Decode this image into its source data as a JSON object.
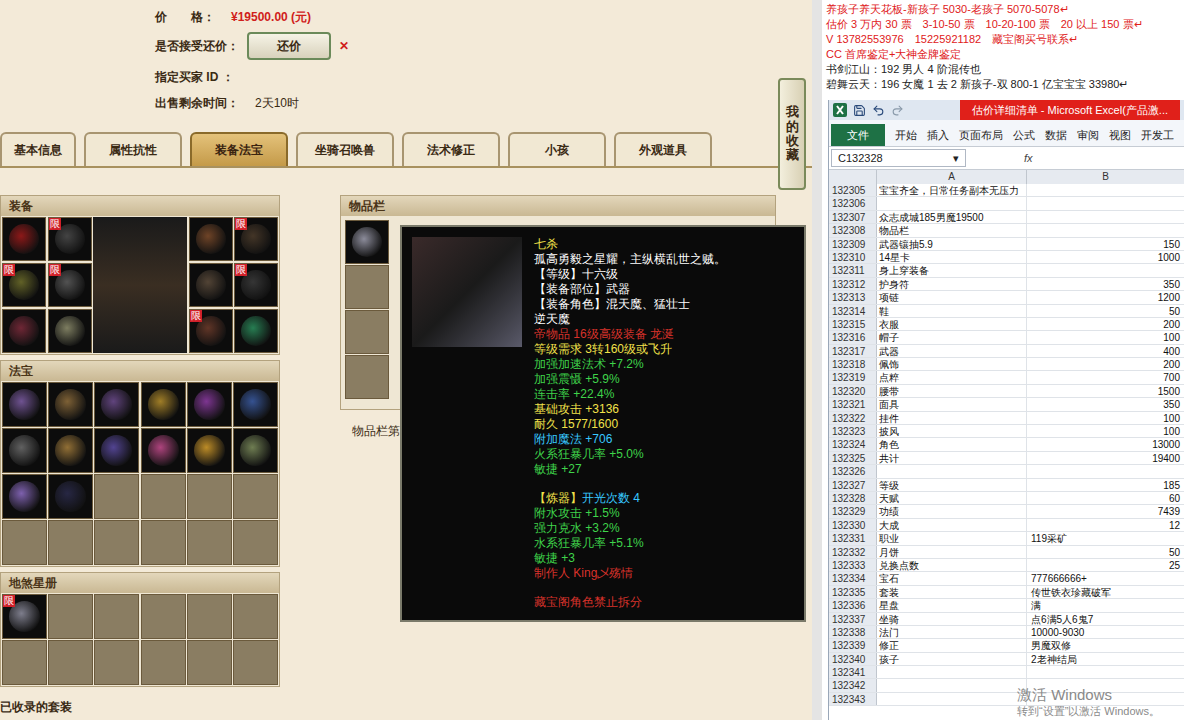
{
  "price": {
    "label": "价　　格：",
    "value": "¥19500.00 (元)"
  },
  "bargain": {
    "label": "是否接受还价：",
    "button": "还价",
    "mark": "✕"
  },
  "buyer": {
    "label": "指定买家 ID ："
  },
  "remaining": {
    "label": "出售剩余时间：",
    "value": "2天10时"
  },
  "favorite_button": "我的收藏",
  "tabs": [
    {
      "label": "基本信息",
      "selected": false
    },
    {
      "label": "属性抗性",
      "selected": false
    },
    {
      "label": "装备法宝",
      "selected": true
    },
    {
      "label": "坐骑召唤兽",
      "selected": false
    },
    {
      "label": "法术修正",
      "selected": false
    },
    {
      "label": "小孩",
      "selected": false
    },
    {
      "label": "外观道具",
      "selected": false
    }
  ],
  "equipment": {
    "title": "装备",
    "left": [
      {
        "filled": true,
        "badge": "",
        "color": "#9b1a1a"
      },
      {
        "filled": true,
        "badge": "限",
        "color": "#4a4a4a"
      },
      {
        "filled": true,
        "badge": "限",
        "color": "#6b6b2a"
      },
      {
        "filled": true,
        "badge": "限",
        "color": "#5a5a5a"
      },
      {
        "filled": true,
        "badge": "",
        "color": "#7a2a3a"
      },
      {
        "filled": true,
        "badge": "",
        "color": "#8a8a6a"
      }
    ],
    "right": [
      {
        "filled": true,
        "badge": "",
        "color": "#7a4a2a"
      },
      {
        "filled": true,
        "badge": "限",
        "color": "#4a3a2a"
      },
      {
        "filled": true,
        "badge": "",
        "color": "#5a4a3a"
      },
      {
        "filled": true,
        "badge": "限",
        "color": "#3a3a3a"
      },
      {
        "filled": true,
        "badge": "限",
        "color": "#6a3a2a"
      },
      {
        "filled": true,
        "badge": "",
        "color": "#2a8a5a"
      }
    ]
  },
  "treasures": {
    "title": "法宝",
    "slots": [
      {
        "filled": true,
        "color": "#7a5aa0"
      },
      {
        "filled": true,
        "color": "#8a6a3a"
      },
      {
        "filled": true,
        "color": "#6a4a8a"
      },
      {
        "filled": true,
        "color": "#b08a2a"
      },
      {
        "filled": true,
        "color": "#8a3aa0"
      },
      {
        "filled": true,
        "color": "#3a5aa0"
      },
      {
        "filled": true,
        "color": "#6a6a6a"
      },
      {
        "filled": true,
        "color": "#a07a3a"
      },
      {
        "filled": true,
        "color": "#5a4aa0"
      },
      {
        "filled": true,
        "color": "#c04a8a"
      },
      {
        "filled": true,
        "color": "#d09a2a"
      },
      {
        "filled": true,
        "color": "#7a8a5a"
      },
      {
        "filled": true,
        "color": "#8a6ac0"
      },
      {
        "filled": true,
        "color": "#2a2a4a"
      },
      {
        "filled": false,
        "color": ""
      },
      {
        "filled": false,
        "color": ""
      },
      {
        "filled": false,
        "color": ""
      },
      {
        "filled": false,
        "color": ""
      },
      {
        "filled": false,
        "color": ""
      },
      {
        "filled": false,
        "color": ""
      },
      {
        "filled": false,
        "color": ""
      },
      {
        "filled": false,
        "color": ""
      },
      {
        "filled": false,
        "color": ""
      },
      {
        "filled": false,
        "color": ""
      }
    ]
  },
  "star_book": {
    "title": "地煞星册",
    "slots": [
      {
        "filled": true,
        "badge": "限",
        "color": "#8a8a9a"
      },
      {
        "filled": false,
        "badge": "",
        "color": ""
      },
      {
        "filled": false,
        "badge": "",
        "color": ""
      },
      {
        "filled": false,
        "badge": "",
        "color": ""
      },
      {
        "filled": false,
        "badge": "",
        "color": ""
      },
      {
        "filled": false,
        "badge": "",
        "color": ""
      },
      {
        "filled": false,
        "badge": "",
        "color": ""
      },
      {
        "filled": false,
        "badge": "",
        "color": ""
      },
      {
        "filled": false,
        "badge": "",
        "color": ""
      },
      {
        "filled": false,
        "badge": "",
        "color": ""
      },
      {
        "filled": false,
        "badge": "",
        "color": ""
      },
      {
        "filled": false,
        "badge": "",
        "color": ""
      }
    ]
  },
  "inventory": {
    "title": "物品栏",
    "caption": "物品栏第",
    "slots": [
      {
        "filled": true,
        "color": "#9a9aaa"
      },
      {
        "filled": false,
        "color": ""
      },
      {
        "filled": false,
        "color": ""
      },
      {
        "filled": false,
        "color": ""
      }
    ]
  },
  "tooltip": {
    "lines": [
      {
        "text": "七杀",
        "color": "#f2e24a",
        "gap_before": false
      },
      {
        "text": "孤高勇毅之星耀，主纵横乱世之贼。",
        "color": "#ffffff",
        "gap_before": false
      },
      {
        "text": "【等级】十六级",
        "color": "#ffffff",
        "gap_before": false
      },
      {
        "text": "【装备部位】武器",
        "color": "#ffffff",
        "gap_before": false
      },
      {
        "text": "【装备角色】混天魔、猛壮士",
        "color": "#ffffff",
        "gap_before": false
      },
      {
        "text": "逆天魔",
        "color": "#ffffff",
        "gap_before": false
      },
      {
        "text": "帝物品 16级高级装备 龙涎",
        "color": "#d8322a",
        "gap_before": false
      },
      {
        "text": "等级需求 3转160级或飞升",
        "color": "#f2e24a",
        "gap_before": false
      },
      {
        "text": "加强加速法术 +7.2%",
        "color": "#3fd44a",
        "gap_before": false
      },
      {
        "text": "加强震慑 +5.9%",
        "color": "#3fd44a",
        "gap_before": false
      },
      {
        "text": "连击率 +22.4%",
        "color": "#3fd44a",
        "gap_before": false
      },
      {
        "text": "基础攻击 +3136",
        "color": "#f2e24a",
        "gap_before": false
      },
      {
        "text": "耐久 1577/1600",
        "color": "#f2e24a",
        "gap_before": false
      },
      {
        "text": "附加魔法 +706",
        "color": "#38c8ff",
        "gap_before": false
      },
      {
        "text": "火系狂暴几率 +5.0%",
        "color": "#3fd44a",
        "gap_before": false
      },
      {
        "text": "敏捷 +27",
        "color": "#3fd44a",
        "gap_before": false
      },
      {
        "text": "【炼器】",
        "color": "#f2e24a",
        "gap_before": true,
        "suffix": "开光次数 4",
        "suffix_color": "#38c8ff"
      },
      {
        "text": "附水攻击 +1.5%",
        "color": "#3fd44a",
        "gap_before": false
      },
      {
        "text": "强力克水 +3.2%",
        "color": "#3fd44a",
        "gap_before": false
      },
      {
        "text": "水系狂暴几率 +5.1%",
        "color": "#3fd44a",
        "gap_before": false
      },
      {
        "text": "敏捷 +3",
        "color": "#3fd44a",
        "gap_before": false
      },
      {
        "text": "制作人 King乄殇情",
        "color": "#d8322a",
        "gap_before": false
      },
      {
        "text": "藏宝阁角色禁止拆分",
        "color": "#d8322a",
        "gap_before": true
      }
    ]
  },
  "bottom_section": "已收录的套装",
  "notes": [
    {
      "text": "养孩子养天花板-新孩子 5030-老孩子 5070-5078↵",
      "color": "#e0201a"
    },
    {
      "text": "估价 3 万内 30 票　3-10-50 票　10-20-100 票　20 以上 150 票↵",
      "color": "#e0201a"
    },
    {
      "text": "V 13782553976　15225921182　藏宝阁买号联系↵",
      "color": "#e0201a"
    },
    {
      "text": "CC 首席鉴定+大神金牌鉴定",
      "color": "#e0201a"
    },
    {
      "text": "书剑江山：192 男人 4 阶混传也",
      "color": "#222222"
    },
    {
      "text": "碧舞云天：196 女魔 1 去 2 新孩子-双 800-1 亿宝宝宝 33980↵",
      "color": "#222222"
    }
  ],
  "excel": {
    "title": "估价详细清单 - Microsoft Excel(产品激...",
    "ribbon": [
      {
        "label": "文件",
        "selected": true
      },
      {
        "label": "开始",
        "selected": false
      },
      {
        "label": "插入",
        "selected": false
      },
      {
        "label": "页面布局",
        "selected": false
      },
      {
        "label": "公式",
        "selected": false
      },
      {
        "label": "数据",
        "selected": false
      },
      {
        "label": "审阅",
        "selected": false
      },
      {
        "label": "视图",
        "selected": false
      },
      {
        "label": "开发工",
        "selected": false
      }
    ],
    "name_box": "C132328",
    "name_box_arrow": "▾",
    "fx": "fx",
    "columns": [
      "A",
      "B"
    ],
    "rows": [
      {
        "num": "132305",
        "a": "宝宝齐全，日常任务副本无压力",
        "b": ""
      },
      {
        "num": "132306",
        "a": "",
        "b": ""
      },
      {
        "num": "132307",
        "a": "众志成城185男魔19500",
        "b": ""
      },
      {
        "num": "132308",
        "a": "物品栏",
        "b": ""
      },
      {
        "num": "132309",
        "a": "武器镶抽5.9",
        "b": "150"
      },
      {
        "num": "132310",
        "a": "14星卡",
        "b": "1000"
      },
      {
        "num": "132311",
        "a": "身上穿装备",
        "b": ""
      },
      {
        "num": "132312",
        "a": "护身符",
        "b": "350"
      },
      {
        "num": "132313",
        "a": "项链",
        "b": "1200"
      },
      {
        "num": "132314",
        "a": "鞋",
        "b": "50"
      },
      {
        "num": "132315",
        "a": "衣服",
        "b": "200"
      },
      {
        "num": "132316",
        "a": "帽子",
        "b": "100"
      },
      {
        "num": "132317",
        "a": "武器",
        "b": "400"
      },
      {
        "num": "132318",
        "a": "佩饰",
        "b": "200"
      },
      {
        "num": "132319",
        "a": "点粹",
        "b": "700"
      },
      {
        "num": "132320",
        "a": "腰带",
        "b": "1500"
      },
      {
        "num": "132321",
        "a": "面具",
        "b": "350"
      },
      {
        "num": "132322",
        "a": "挂件",
        "b": "100"
      },
      {
        "num": "132323",
        "a": "披风",
        "b": "100"
      },
      {
        "num": "132324",
        "a": "角色",
        "b": "13000"
      },
      {
        "num": "132325",
        "a": "共计",
        "b": "19400"
      },
      {
        "num": "132326",
        "a": "",
        "b": ""
      },
      {
        "num": "132327",
        "a": "等级",
        "b": "185"
      },
      {
        "num": "132328",
        "a": "天赋",
        "b": "60"
      },
      {
        "num": "132329",
        "a": "功绩",
        "b": "7439"
      },
      {
        "num": "132330",
        "a": "大成",
        "b": "12"
      },
      {
        "num": "132331",
        "a": "职业",
        "b": "119采矿"
      },
      {
        "num": "132332",
        "a": "月饼",
        "b": "50"
      },
      {
        "num": "132333",
        "a": "兑换点数",
        "b": "25"
      },
      {
        "num": "132334",
        "a": "宝石",
        "b": "777666666+"
      },
      {
        "num": "132335",
        "a": "套装",
        "b": "传世铁衣珍藏破军"
      },
      {
        "num": "132336",
        "a": "星盘",
        "b": "满"
      },
      {
        "num": "132337",
        "a": "坐骑",
        "b": "点6满5人6鬼7"
      },
      {
        "num": "132338",
        "a": "法门",
        "b": "10000-9030"
      },
      {
        "num": "132339",
        "a": "修正",
        "b": "男魔双修"
      },
      {
        "num": "132340",
        "a": "孩子",
        "b": "2老神结局"
      },
      {
        "num": "132341",
        "a": "",
        "b": ""
      },
      {
        "num": "132342",
        "a": "",
        "b": ""
      },
      {
        "num": "132343",
        "a": "",
        "b": ""
      }
    ]
  },
  "watermark": {
    "title": "激活 Windows",
    "subtitle": "转到“设置”以激活 Windows。"
  }
}
